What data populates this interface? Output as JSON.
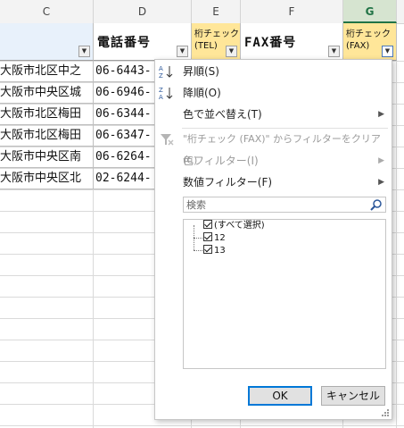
{
  "columns": [
    "C",
    "D",
    "E",
    "F",
    "G"
  ],
  "headers": {
    "c": "",
    "d": "電話番号",
    "e_line1": "桁チェック",
    "e_line2": "(TEL)",
    "f": "FAX番号",
    "g_line1": "桁チェック",
    "g_line2": "(FAX)"
  },
  "rows": [
    {
      "address": "大阪市北区中之",
      "tel": "06-6443-"
    },
    {
      "address": "大阪市中央区城",
      "tel": "06-6946-"
    },
    {
      "address": "大阪市北区梅田",
      "tel": "06-6344-"
    },
    {
      "address": "大阪市北区梅田",
      "tel": "06-6347-"
    },
    {
      "address": "大阪市中央区南",
      "tel": "06-6264-"
    },
    {
      "address": "大阪市中央区北",
      "tel": "02-6244-"
    }
  ],
  "menu": {
    "sort_asc": "昇順(S)",
    "sort_desc": "降順(O)",
    "sort_by_color": "色で並べ替え(T)",
    "clear_filter": "\"桁チェック (FAX)\" からフィルターをクリア(C)",
    "color_filter": "色フィルター(I)",
    "number_filter": "数値フィルター(F)"
  },
  "search": {
    "placeholder": "検索"
  },
  "filter_list": [
    {
      "label": "(すべて選択)",
      "checked": true
    },
    {
      "label": "12",
      "checked": true
    },
    {
      "label": "13",
      "checked": true
    }
  ],
  "buttons": {
    "ok": "OK",
    "cancel": "キャンセル"
  },
  "colors": {
    "accent_header": "#ffe699",
    "selected_col": "#217346"
  },
  "icons": [
    "sort-asc-icon",
    "sort-desc-icon",
    "clear-filter-icon",
    "search-icon",
    "dropdown-arrow-icon",
    "submenu-arrow-icon"
  ]
}
